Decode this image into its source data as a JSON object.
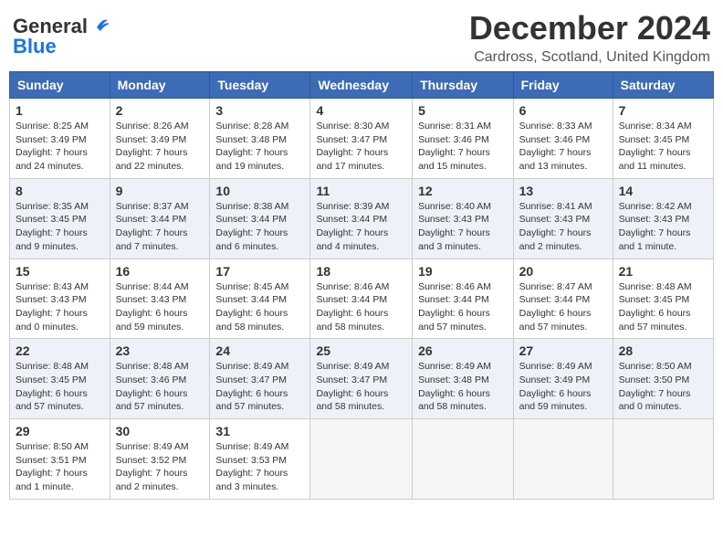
{
  "logo": {
    "general": "General",
    "blue": "Blue"
  },
  "title": "December 2024",
  "location": "Cardross, Scotland, United Kingdom",
  "days_of_week": [
    "Sunday",
    "Monday",
    "Tuesday",
    "Wednesday",
    "Thursday",
    "Friday",
    "Saturday"
  ],
  "weeks": [
    [
      {
        "day": "1",
        "info": "Sunrise: 8:25 AM\nSunset: 3:49 PM\nDaylight: 7 hours and 24 minutes."
      },
      {
        "day": "2",
        "info": "Sunrise: 8:26 AM\nSunset: 3:49 PM\nDaylight: 7 hours and 22 minutes."
      },
      {
        "day": "3",
        "info": "Sunrise: 8:28 AM\nSunset: 3:48 PM\nDaylight: 7 hours and 19 minutes."
      },
      {
        "day": "4",
        "info": "Sunrise: 8:30 AM\nSunset: 3:47 PM\nDaylight: 7 hours and 17 minutes."
      },
      {
        "day": "5",
        "info": "Sunrise: 8:31 AM\nSunset: 3:46 PM\nDaylight: 7 hours and 15 minutes."
      },
      {
        "day": "6",
        "info": "Sunrise: 8:33 AM\nSunset: 3:46 PM\nDaylight: 7 hours and 13 minutes."
      },
      {
        "day": "7",
        "info": "Sunrise: 8:34 AM\nSunset: 3:45 PM\nDaylight: 7 hours and 11 minutes."
      }
    ],
    [
      {
        "day": "8",
        "info": "Sunrise: 8:35 AM\nSunset: 3:45 PM\nDaylight: 7 hours and 9 minutes."
      },
      {
        "day": "9",
        "info": "Sunrise: 8:37 AM\nSunset: 3:44 PM\nDaylight: 7 hours and 7 minutes."
      },
      {
        "day": "10",
        "info": "Sunrise: 8:38 AM\nSunset: 3:44 PM\nDaylight: 7 hours and 6 minutes."
      },
      {
        "day": "11",
        "info": "Sunrise: 8:39 AM\nSunset: 3:44 PM\nDaylight: 7 hours and 4 minutes."
      },
      {
        "day": "12",
        "info": "Sunrise: 8:40 AM\nSunset: 3:43 PM\nDaylight: 7 hours and 3 minutes."
      },
      {
        "day": "13",
        "info": "Sunrise: 8:41 AM\nSunset: 3:43 PM\nDaylight: 7 hours and 2 minutes."
      },
      {
        "day": "14",
        "info": "Sunrise: 8:42 AM\nSunset: 3:43 PM\nDaylight: 7 hours and 1 minute."
      }
    ],
    [
      {
        "day": "15",
        "info": "Sunrise: 8:43 AM\nSunset: 3:43 PM\nDaylight: 7 hours and 0 minutes."
      },
      {
        "day": "16",
        "info": "Sunrise: 8:44 AM\nSunset: 3:43 PM\nDaylight: 6 hours and 59 minutes."
      },
      {
        "day": "17",
        "info": "Sunrise: 8:45 AM\nSunset: 3:44 PM\nDaylight: 6 hours and 58 minutes."
      },
      {
        "day": "18",
        "info": "Sunrise: 8:46 AM\nSunset: 3:44 PM\nDaylight: 6 hours and 58 minutes."
      },
      {
        "day": "19",
        "info": "Sunrise: 8:46 AM\nSunset: 3:44 PM\nDaylight: 6 hours and 57 minutes."
      },
      {
        "day": "20",
        "info": "Sunrise: 8:47 AM\nSunset: 3:44 PM\nDaylight: 6 hours and 57 minutes."
      },
      {
        "day": "21",
        "info": "Sunrise: 8:48 AM\nSunset: 3:45 PM\nDaylight: 6 hours and 57 minutes."
      }
    ],
    [
      {
        "day": "22",
        "info": "Sunrise: 8:48 AM\nSunset: 3:45 PM\nDaylight: 6 hours and 57 minutes."
      },
      {
        "day": "23",
        "info": "Sunrise: 8:48 AM\nSunset: 3:46 PM\nDaylight: 6 hours and 57 minutes."
      },
      {
        "day": "24",
        "info": "Sunrise: 8:49 AM\nSunset: 3:47 PM\nDaylight: 6 hours and 57 minutes."
      },
      {
        "day": "25",
        "info": "Sunrise: 8:49 AM\nSunset: 3:47 PM\nDaylight: 6 hours and 58 minutes."
      },
      {
        "day": "26",
        "info": "Sunrise: 8:49 AM\nSunset: 3:48 PM\nDaylight: 6 hours and 58 minutes."
      },
      {
        "day": "27",
        "info": "Sunrise: 8:49 AM\nSunset: 3:49 PM\nDaylight: 6 hours and 59 minutes."
      },
      {
        "day": "28",
        "info": "Sunrise: 8:50 AM\nSunset: 3:50 PM\nDaylight: 7 hours and 0 minutes."
      }
    ],
    [
      {
        "day": "29",
        "info": "Sunrise: 8:50 AM\nSunset: 3:51 PM\nDaylight: 7 hours and 1 minute."
      },
      {
        "day": "30",
        "info": "Sunrise: 8:49 AM\nSunset: 3:52 PM\nDaylight: 7 hours and 2 minutes."
      },
      {
        "day": "31",
        "info": "Sunrise: 8:49 AM\nSunset: 3:53 PM\nDaylight: 7 hours and 3 minutes."
      },
      {
        "day": "",
        "info": ""
      },
      {
        "day": "",
        "info": ""
      },
      {
        "day": "",
        "info": ""
      },
      {
        "day": "",
        "info": ""
      }
    ]
  ]
}
